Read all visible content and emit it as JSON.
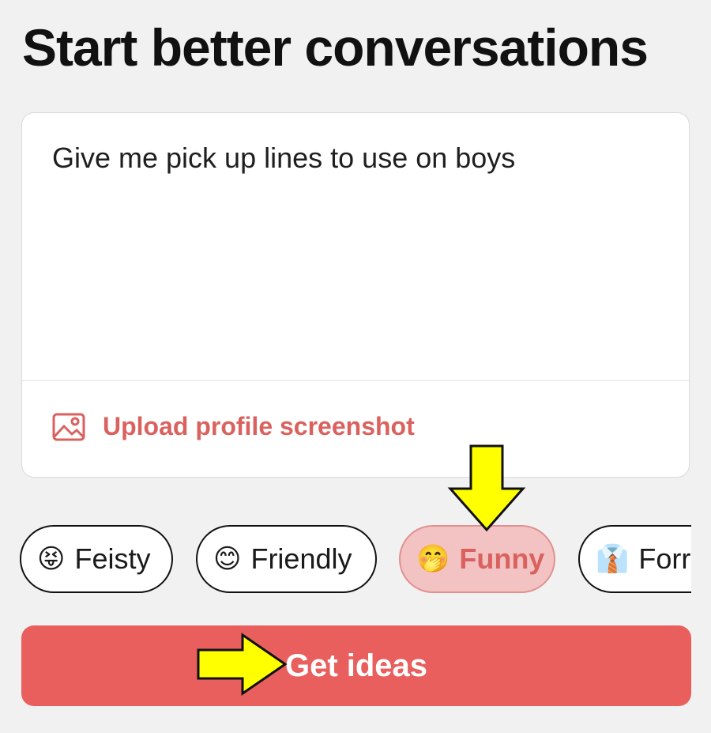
{
  "header": {
    "title": "Start better conversations"
  },
  "composer": {
    "prompt_text": "Give me pick up lines to use on boys",
    "upload_label": "Upload profile screenshot"
  },
  "tones": [
    {
      "emoji": "😝",
      "label": "Feisty",
      "selected": false
    },
    {
      "emoji": "😊",
      "label": "Friendly",
      "selected": false
    },
    {
      "emoji": "🤭",
      "label": "Funny",
      "selected": true
    },
    {
      "emoji": "👔",
      "label": "Forr",
      "selected": false
    }
  ],
  "cta": {
    "label": "Get ideas"
  },
  "colors": {
    "accent": "#e85f5e",
    "accent_text": "#d9625f",
    "selected_chip_bg": "#f2c3c2",
    "annotation_arrow": "#ffff00"
  },
  "annotations": {
    "arrow_down_target": "tone-chip-funny",
    "arrow_right_target": "get-ideas-button"
  }
}
